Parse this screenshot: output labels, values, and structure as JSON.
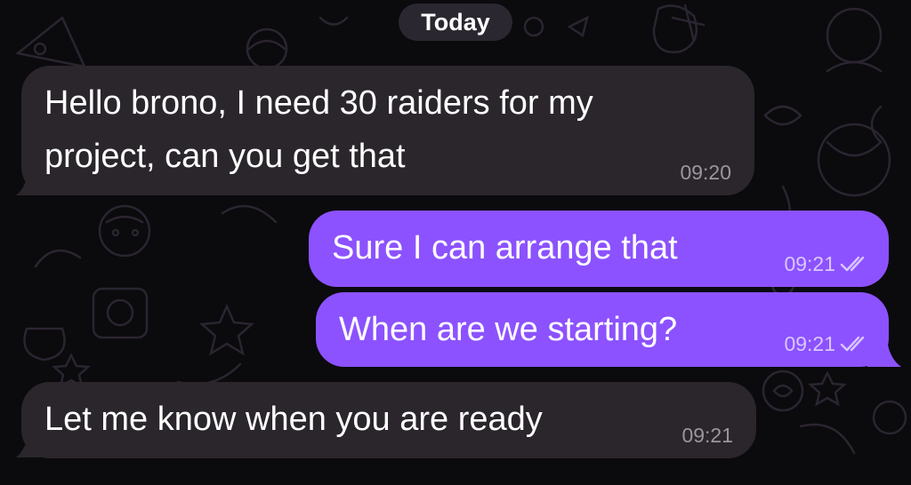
{
  "date_separator": "Today",
  "messages": [
    {
      "direction": "incoming",
      "text": "Hello brono, I need 30 raiders for my\nproject, can you get that",
      "time": "09:20"
    },
    {
      "direction": "outgoing",
      "text": "Sure I can arrange that",
      "time": "09:21",
      "status": "read"
    },
    {
      "direction": "outgoing",
      "text": "When are we starting?",
      "time": "09:21",
      "status": "read"
    },
    {
      "direction": "incoming",
      "text": "Let me know when you are ready",
      "time": "09:21"
    }
  ],
  "colors": {
    "background": "#0b0a0d",
    "incoming_bubble": "#2a262c",
    "outgoing_bubble": "#8c52ff",
    "date_pill": "#2b2730"
  },
  "icons": {
    "read_receipt": "double-check-icon"
  }
}
